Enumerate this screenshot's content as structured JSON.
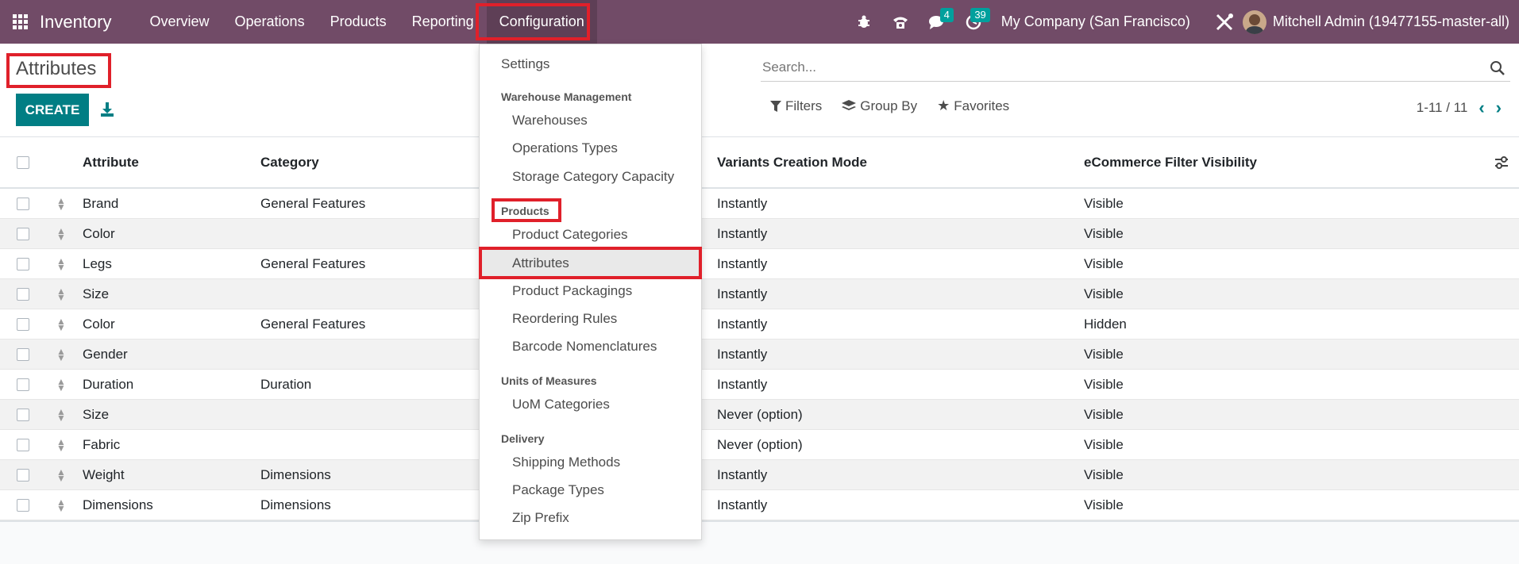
{
  "navbar": {
    "app_name": "Inventory",
    "menu": [
      "Overview",
      "Operations",
      "Products",
      "Reporting",
      "Configuration"
    ],
    "active_menu": "Configuration",
    "messages_count": "4",
    "activities_count": "39",
    "company": "My Company (San Francisco)",
    "user": "Mitchell Admin (19477155-master-all)"
  },
  "control": {
    "title": "Attributes",
    "create_label": "CREATE",
    "search_placeholder": "Search...",
    "filters_label": "Filters",
    "groupby_label": "Group By",
    "favorites_label": "Favorites",
    "pager": "1-11 / 11"
  },
  "table": {
    "headers": {
      "attribute": "Attribute",
      "category": "Category",
      "mode": "Variants Creation Mode",
      "visibility": "eCommerce Filter Visibility"
    },
    "rows": [
      {
        "attribute": "Brand",
        "category": "General Features",
        "mode": "Instantly",
        "visibility": "Visible"
      },
      {
        "attribute": "Color",
        "category": "",
        "mode": "Instantly",
        "visibility": "Visible"
      },
      {
        "attribute": "Legs",
        "category": "General Features",
        "mode": "Instantly",
        "visibility": "Visible"
      },
      {
        "attribute": "Size",
        "category": "",
        "mode": "Instantly",
        "visibility": "Visible"
      },
      {
        "attribute": "Color",
        "category": "General Features",
        "mode": "Instantly",
        "visibility": "Hidden"
      },
      {
        "attribute": "Gender",
        "category": "",
        "mode": "Instantly",
        "visibility": "Visible"
      },
      {
        "attribute": "Duration",
        "category": "Duration",
        "mode": "Instantly",
        "visibility": "Visible"
      },
      {
        "attribute": "Size",
        "category": "",
        "mode": "Never (option)",
        "visibility": "Visible"
      },
      {
        "attribute": "Fabric",
        "category": "",
        "mode": "Never (option)",
        "visibility": "Visible"
      },
      {
        "attribute": "Weight",
        "category": "Dimensions",
        "mode": "Instantly",
        "visibility": "Visible"
      },
      {
        "attribute": "Dimensions",
        "category": "Dimensions",
        "mode": "Instantly",
        "visibility": "Visible"
      }
    ]
  },
  "dropdown": {
    "settings": "Settings",
    "warehouse_header": "Warehouse Management",
    "warehouses": "Warehouses",
    "operations_types": "Operations Types",
    "storage_capacity": "Storage Category Capacity",
    "products_header": "Products",
    "product_categories": "Product Categories",
    "attributes": "Attributes",
    "product_packagings": "Product Packagings",
    "reordering_rules": "Reordering Rules",
    "barcode_nomenclatures": "Barcode Nomenclatures",
    "uom_header": "Units of Measures",
    "uom_categories": "UoM Categories",
    "delivery_header": "Delivery",
    "shipping_methods": "Shipping Methods",
    "package_types": "Package Types",
    "zip_prefix": "Zip Prefix"
  },
  "colors": {
    "navbar": "#714b67",
    "primary": "#017e84",
    "highlight": "#e0202a"
  }
}
